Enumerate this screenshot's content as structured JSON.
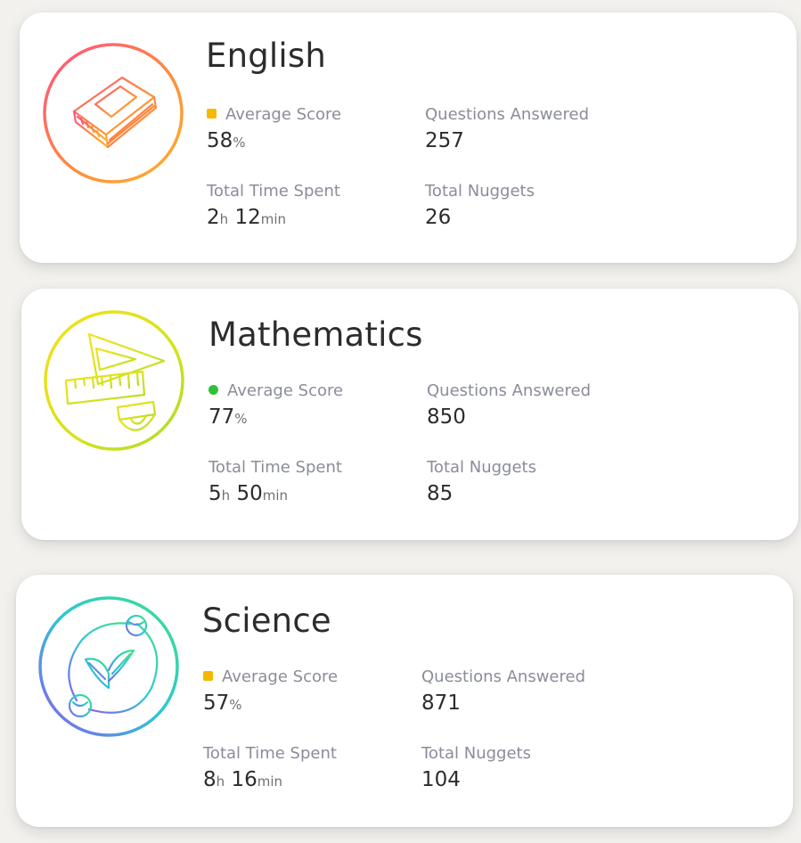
{
  "labels": {
    "average_score": "Average Score",
    "questions_answered": "Questions Answered",
    "total_time_spent": "Total Time Spent",
    "total_nuggets": "Total Nuggets",
    "percent_unit": "%",
    "hours_unit": "h",
    "minutes_unit": "min"
  },
  "subjects": [
    {
      "name": "English",
      "icon": "book-icon",
      "score_indicator_color": "#f5b800",
      "score_indicator_shape": "square",
      "average_score": "58",
      "questions_answered": "257",
      "time_hours": "2",
      "time_minutes": "12",
      "total_nuggets": "26"
    },
    {
      "name": "Mathematics",
      "icon": "geometry-tools-icon",
      "score_indicator_color": "#2ec23a",
      "score_indicator_shape": "circle",
      "average_score": "77",
      "questions_answered": "850",
      "time_hours": "5",
      "time_minutes": "50",
      "total_nuggets": "85"
    },
    {
      "name": "Science",
      "icon": "plant-icon",
      "score_indicator_color": "#f5b800",
      "score_indicator_shape": "square",
      "average_score": "57",
      "questions_answered": "871",
      "time_hours": "8",
      "time_minutes": "16",
      "total_nuggets": "104"
    }
  ]
}
